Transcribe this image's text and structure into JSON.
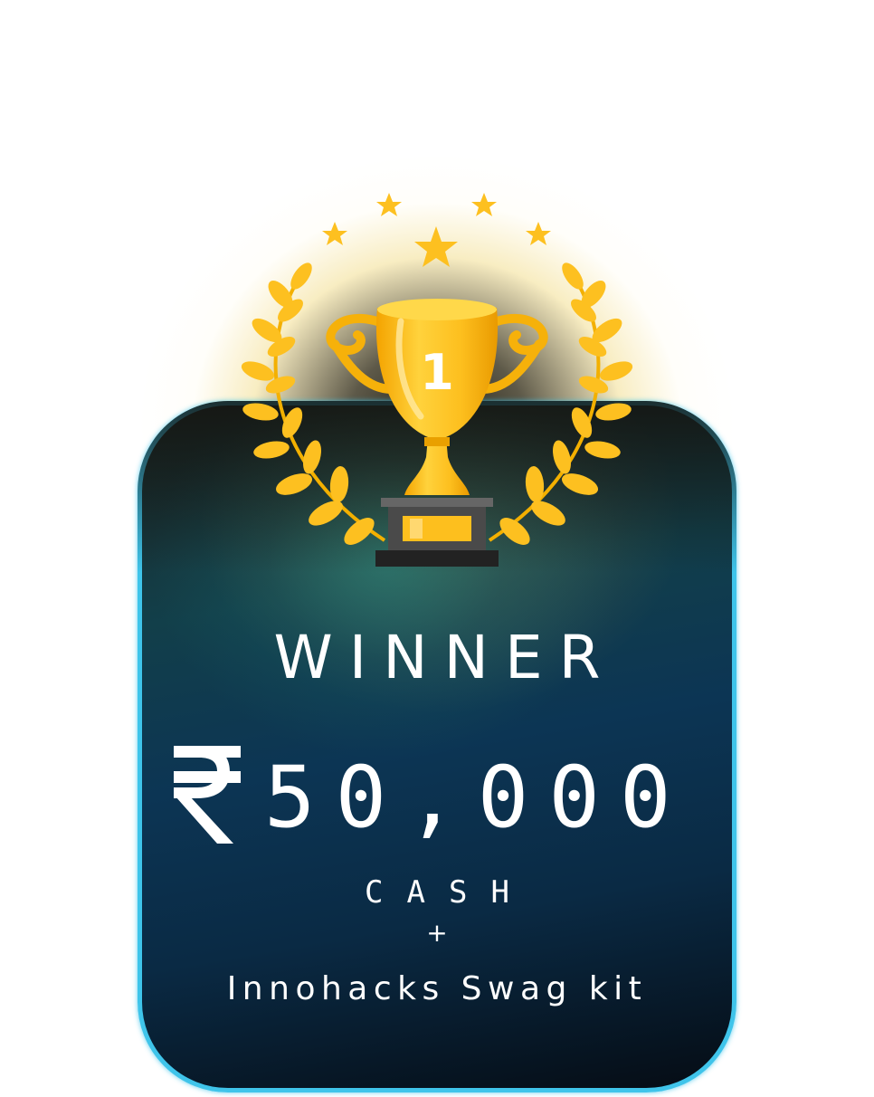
{
  "badge": {
    "rank": "1",
    "title": "WINNER",
    "currency_symbol": "₹",
    "amount": "50,000",
    "prize_type": "CASH",
    "plus": "+",
    "extra": "Innohacks Swag kit"
  },
  "colors": {
    "gold": "#fdc020",
    "gold_dark": "#f0a400",
    "card_border": "#3fc4ea",
    "base": "#4a4a4a",
    "text": "#ffffff"
  },
  "icons": [
    "star-icon",
    "laurel-wreath-icon",
    "trophy-icon",
    "rupee-icon"
  ]
}
